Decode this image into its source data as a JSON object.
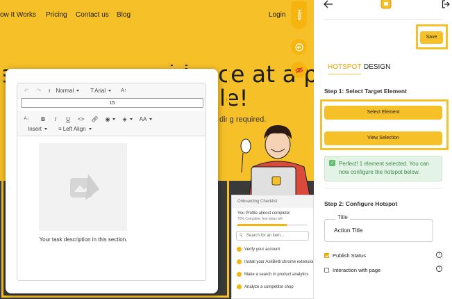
{
  "site": {
    "nav": {
      "how": "ow It Works",
      "pricing": "Pricing",
      "contact": "Contact us",
      "blog": "Blog",
      "login": "Login"
    },
    "hero_line1": "s on-screen guidance at a price",
    "hero_line2": "le!",
    "hero_sub": "ding required.",
    "hide_label": "Hide"
  },
  "checklist": {
    "header": "Onboarding Checklist",
    "progress": "You Profile almost complete!",
    "progress_sub": "70% Complete. few steps left",
    "progress_value": 0.7,
    "search_placeholder": "Search for an item...",
    "items": [
      "Verify your account",
      "Install your AskBetti chrome extension",
      "Make a search in product analytics",
      "Analyze a competitor shop"
    ]
  },
  "editor": {
    "toolbar": {
      "paragraph_style": "Normal",
      "font_family": "Arial",
      "font_size_value": "15",
      "insert": "Insert",
      "align": "Left Align",
      "aa": "AA"
    },
    "task_description": "Your task description in this section."
  },
  "panel": {
    "tabs": {
      "hotspot": "HOTSPOT",
      "design": "DESIGN"
    },
    "save": "Save",
    "step1": "Step 1: Select Target Element",
    "select_element": "Select Element",
    "view_selection": "View Selection",
    "success": "Perfect! 1 element selected. You can now configure the hotspot below.",
    "step2": "Step 2: Configure Hotspot",
    "title_label": "Title",
    "title_value": "Action Title",
    "publish_status": "Publish Status",
    "publish_checked": true,
    "interaction": "Interaction with page",
    "interaction_checked": false
  },
  "colors": {
    "brand_yellow": "#f6c028",
    "accent_orange": "#e8a400",
    "success_green": "#3c8a4a"
  },
  "icons": [
    "back-arrow-icon",
    "logo-icon",
    "logout-icon",
    "eye-off-icon",
    "undo-icon",
    "redo-icon",
    "bold-icon",
    "italic-icon",
    "underline-icon",
    "code-icon",
    "link-icon",
    "palette-icon",
    "fill-icon",
    "image-placeholder-icon",
    "help-icon"
  ]
}
